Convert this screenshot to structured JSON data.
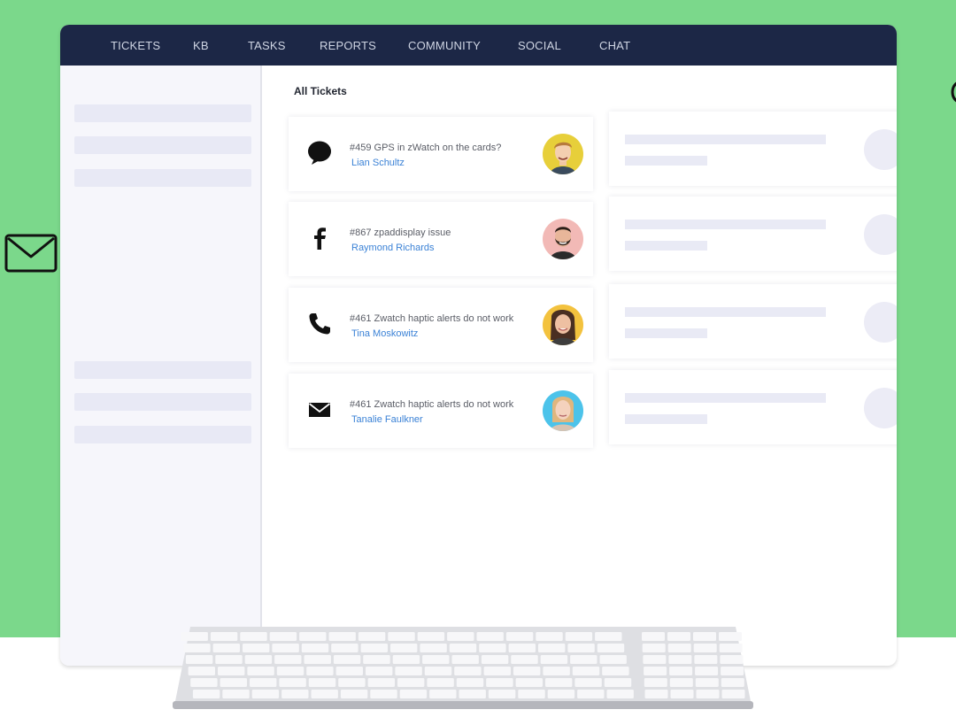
{
  "nav": {
    "items": [
      {
        "label": "TICKETS"
      },
      {
        "label": "KB"
      },
      {
        "label": "TASKS"
      },
      {
        "label": "REPORTS"
      },
      {
        "label": "COMMUNITY"
      },
      {
        "label": "SOCIAL"
      },
      {
        "label": "CHAT"
      }
    ]
  },
  "main": {
    "title": "All Tickets",
    "tickets": [
      {
        "subject": "#459 GPS in zWatch on the cards?",
        "contact": "Lian Schultz",
        "channel_icon": "chat-bubble-icon",
        "avatar_bg": "#e7cf3a"
      },
      {
        "subject": "#867 zpaddisplay issue",
        "contact": "Raymond Richards",
        "channel_icon": "facebook-icon",
        "avatar_bg": "#f2b9b6"
      },
      {
        "subject": "#461 Zwatch haptic alerts do not work",
        "contact": "Tina Moskowitz",
        "channel_icon": "phone-icon",
        "avatar_bg": "#f3c23e"
      },
      {
        "subject": "#461 Zwatch haptic alerts do not work",
        "contact": "Tanalie Faulkner",
        "channel_icon": "mail-icon",
        "avatar_bg": "#4cc3ea"
      }
    ]
  },
  "colors": {
    "background_green": "#7bd88b",
    "nav_bg": "#1c2746",
    "link_blue": "#3b82d6"
  }
}
